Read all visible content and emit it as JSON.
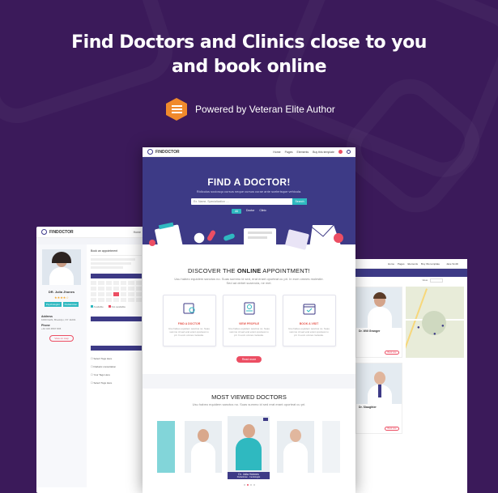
{
  "headline": {
    "line1": "Find Doctors and Clinics close to you",
    "line2": "and book online"
  },
  "powered_by": "Powered by Veteran Elite Author",
  "main_mockup": {
    "logo": "FINDOCTOR",
    "nav": [
      "Home",
      "Pages",
      "Elements",
      "Buy this template"
    ],
    "hero_title": "FIND A DOCTOR!",
    "hero_sub": "Ridiculus sociosqu cursus neque cursus curae ante scelerisque vehicula.",
    "search_placeholder": "Ex. Name, Specialization ....",
    "search_button": "Search",
    "radios": [
      "All",
      "Doctor",
      "Clinic"
    ],
    "discover_prefix": "DISCOVER THE ",
    "discover_bold": "ONLINE",
    "discover_suffix": " APPOINTMENT!",
    "discover_desc": "Usu habeo equidem sanctus no. Suas summo id sed, erat erant oporteat cu pri. In eum omnes molestie. Sed ad debet scaevola, ne mel.",
    "cards": [
      {
        "title": "FIND A DOCTOR",
        "desc": "Usu habeo equidem sanctus no. Suas summo id sed erat erant oporteat cu pri. In eum omnes molestie."
      },
      {
        "title": "VIEW PROFILE",
        "desc": "Usu habeo equidem sanctus no. Suas summo id sed erat erant oporteat cu pri. In eum omnes molestie."
      },
      {
        "title": "BOOK A VISIT",
        "desc": "Usu habeo equidem sanctus no. Suas summo id sed erat erant oporteat cu pri. In eum omnes molestie."
      }
    ],
    "read_more": "Read more",
    "most_viewed_title": "MOST VIEWED DOCTORS",
    "most_viewed_desc": "Usu habeo equidem sanctus no. Suas summo id sed erat erant oporteat cu pri.",
    "featured_doctor": "Dr. Julia Holmes",
    "featured_spec": "Pediatrician - Cardiologist"
  },
  "left_mockup": {
    "logo": "FINDOCTOR",
    "nav_item": "Home",
    "breadcrumb": "Home > Category > Page active",
    "doctor_name": "DR. Julia Jhones",
    "tags": [
      "Psychologist",
      "Pediatrician"
    ],
    "address_label": "Address",
    "address": "1000 Delhi, Brooklyn, NY 11201",
    "phone_label": "Phone",
    "phone": "+44 423 4567 845",
    "view_map": "View on map",
    "book_tab": "Book an appointment",
    "legend": [
      "Available",
      "Not available"
    ],
    "time_slots": [
      "Select Tags Here",
      "Diabetic consultation",
      "Your Tags Here",
      "Select Tags Here"
    ]
  },
  "right_mockup": {
    "nav": [
      "Home",
      "Pages",
      "Elements",
      "Buy this template"
    ],
    "user": "Jane Smith",
    "filter_label": "View",
    "doctors": [
      {
        "name": "Dr. Will Granger",
        "button": "Book now"
      },
      {
        "name": "Dr. Slaughter",
        "button": "Book now"
      }
    ]
  },
  "colors": {
    "background": "#3b1a5a",
    "hero": "#3d3a86",
    "accent_teal": "#2fb9c0",
    "accent_red": "#ec4e63",
    "logo_orange": "#f08a2c"
  }
}
